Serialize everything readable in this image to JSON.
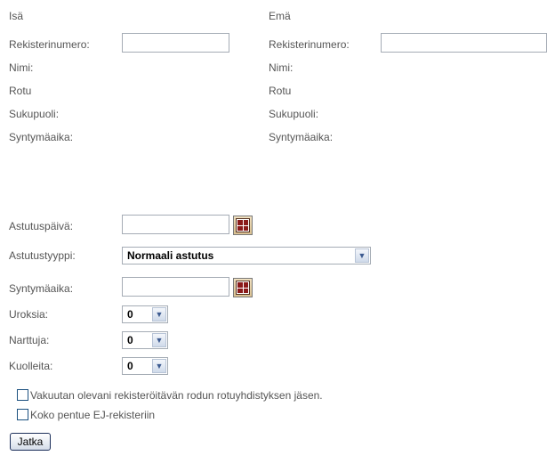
{
  "sire": {
    "heading": "Isä",
    "reg_label": "Rekisterinumero:",
    "reg_value": "",
    "name_label": "Nimi:",
    "breed_label": "Rotu",
    "sex_label": "Sukupuoli:",
    "birth_label": "Syntymäaika:"
  },
  "dam": {
    "heading": "Emä",
    "reg_label": "Rekisterinumero:",
    "reg_value": "",
    "name_label": "Nimi:",
    "breed_label": "Rotu",
    "sex_label": "Sukupuoli:",
    "birth_label": "Syntymäaika:"
  },
  "mating": {
    "date_label": "Astutuspäivä:",
    "date_value": "",
    "type_label": "Astutustyyppi:",
    "type_value": "Normaali astutus",
    "litter_birth_label": "Syntymäaika:",
    "litter_birth_value": "",
    "males_label": "Uroksia:",
    "males_value": "0",
    "females_label": "Narttuja:",
    "females_value": "0",
    "dead_label": "Kuolleita:",
    "dead_value": "0"
  },
  "checkboxes": {
    "member_label": "Vakuutan olevani rekisteröitävän rodun rotuyhdistyksen jäsen.",
    "member_checked": false,
    "ej_label": "Koko pentue EJ-rekisteriin",
    "ej_checked": false
  },
  "actions": {
    "continue_label": "Jatka"
  },
  "icons": {
    "calendar": "calendar-icon",
    "dropdown": "chevron-down-icon"
  }
}
